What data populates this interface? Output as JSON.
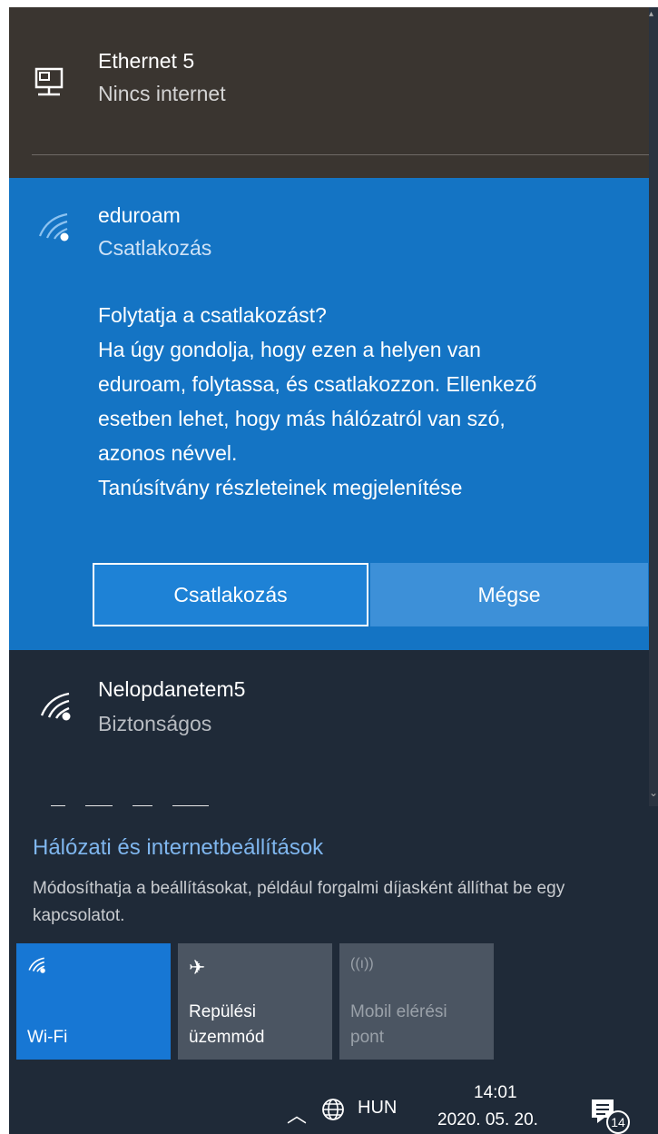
{
  "ethernet": {
    "name": "Ethernet 5",
    "status": "Nincs internet",
    "icon": "ethernet-icon"
  },
  "selected_network": {
    "name": "eduroam",
    "status": "Csatlakozás",
    "message_lines": [
      "Folytatja a csatlakozást?",
      "Ha úgy gondolja, hogy ezen a helyen van",
      "eduroam, folytassa, és csatlakozzon. Ellenkező",
      "esetben lehet, hogy más hálózatról van szó,",
      "azonos névvel.",
      "Tanúsítvány részleteinek megjelenítése"
    ],
    "connect_label": "Csatlakozás",
    "cancel_label": "Mégse"
  },
  "networks": [
    {
      "name": "Nelopdanetem5",
      "status": "Biztonságos",
      "icon": "wifi-icon"
    }
  ],
  "settings": {
    "title": "Hálózati és internetbeállítások",
    "description": "Módosíthatja a beállításokat, például forgalmi díjasként állíthat be egy kapcsolatot."
  },
  "quick_actions": [
    {
      "label": "Wi-Fi",
      "icon": "wifi-icon",
      "active": true
    },
    {
      "label": "Repülési\nüzemmód",
      "icon": "airplane-icon",
      "active": false
    },
    {
      "label": "Mobil elérési\npont",
      "icon": "hotspot-icon",
      "active": false,
      "disabled": true
    }
  ],
  "taskbar": {
    "language": "HUN",
    "time": "14:01",
    "date": "2020. 05. 20.",
    "notification_count": "14"
  },
  "colors": {
    "accent": "#1474c4",
    "panel": "#1f2a38",
    "ethernet_panel": "#3a3530",
    "link": "#7fb6ee"
  }
}
